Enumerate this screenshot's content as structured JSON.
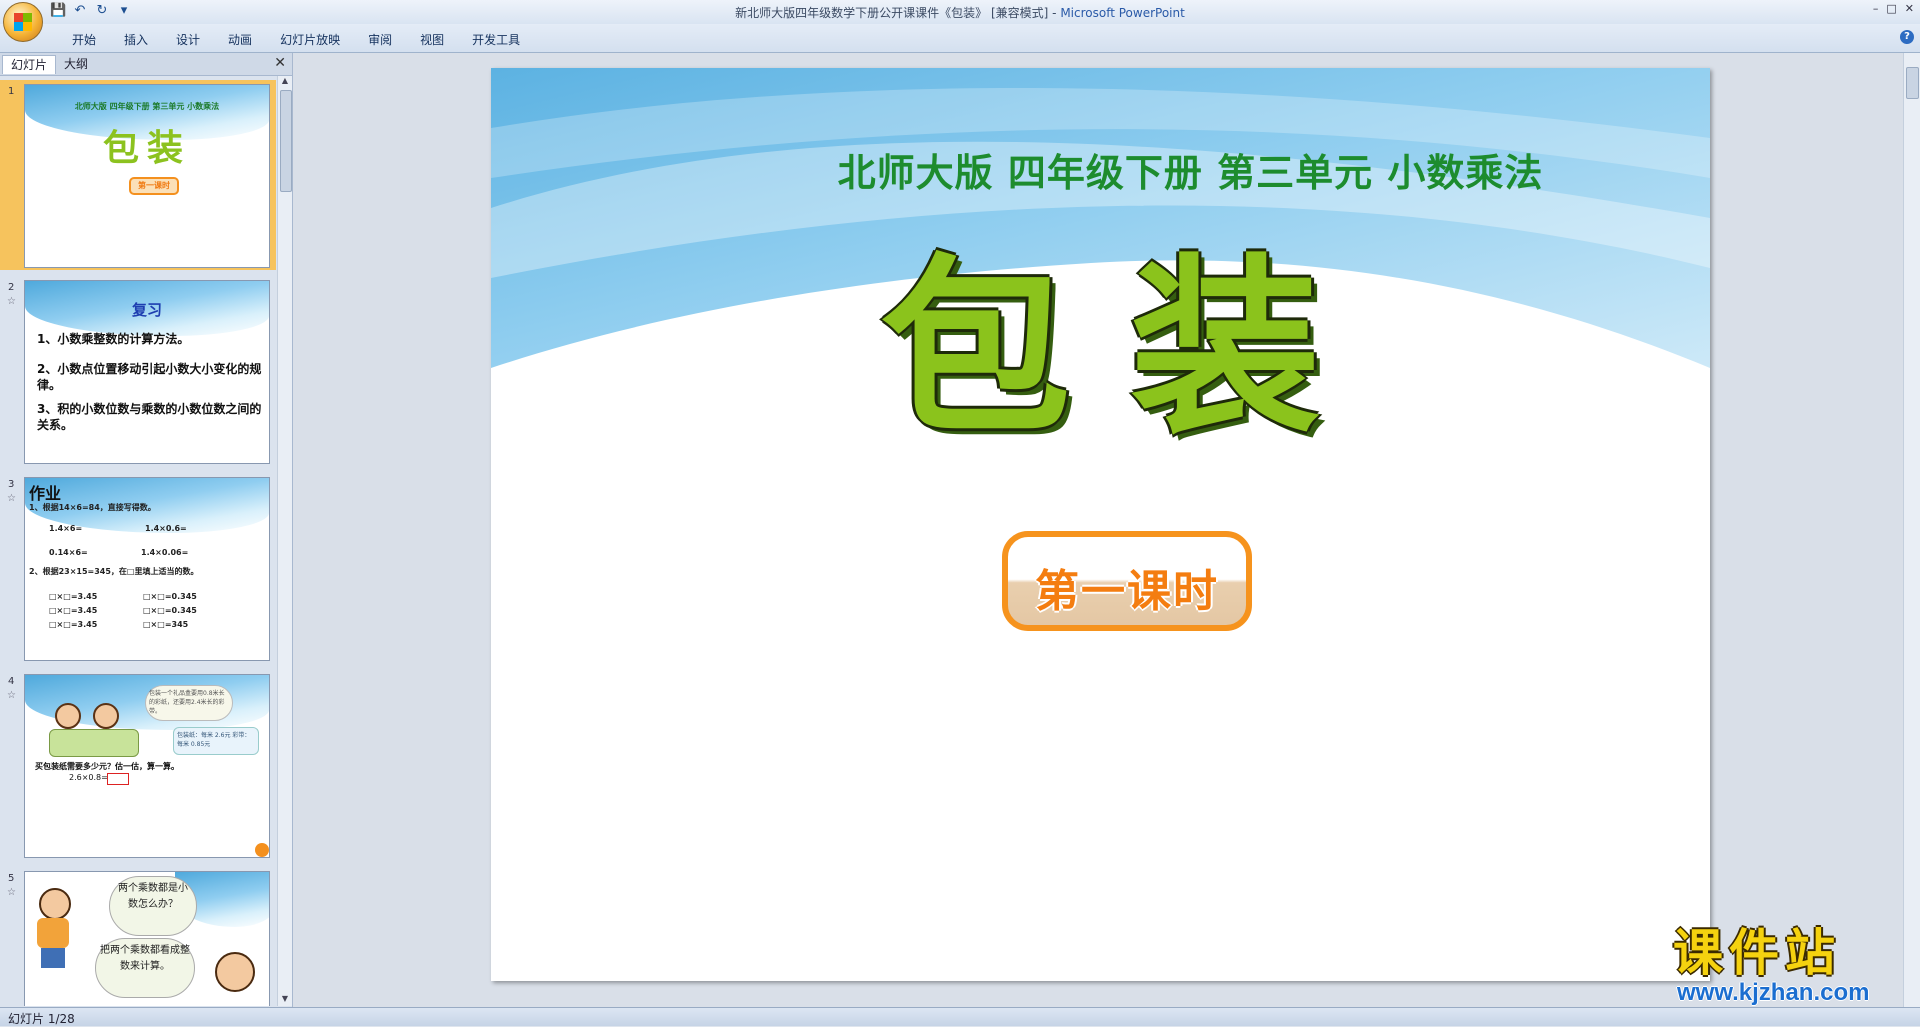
{
  "window": {
    "title": "新北师大版四年级数学下册公开课课件《包装》 [兼容模式] - ",
    "app_name": "Microsoft PowerPoint",
    "minimize": "–",
    "maximize": "□",
    "close": "✕"
  },
  "quick_access": {
    "save": "💾",
    "undo": "↶",
    "redo": "↻",
    "more": "▾"
  },
  "ribbon": {
    "tabs": [
      "开始",
      "插入",
      "设计",
      "动画",
      "幻灯片放映",
      "审阅",
      "视图",
      "开发工具"
    ],
    "help": "?"
  },
  "panel": {
    "tab_slides": "幻灯片",
    "tab_outline": "大纲",
    "close": "✕"
  },
  "thumbnails": {
    "s1": {
      "num": "1",
      "sub": "北师大版  四年级下册  第三单元  小数乘法",
      "title": "包装",
      "button": "第一课时"
    },
    "s2": {
      "num": "2",
      "star": "☆",
      "title": "复习",
      "l1": "1、小数乘整数的计算方法。",
      "l2": "2、小数点位置移动引起小数大小变化的规律。",
      "l3": "3、积的小数位数与乘数的小数位数之间的关系。"
    },
    "s3": {
      "num": "3",
      "star": "☆",
      "title": "作业",
      "q1": "1、根据14×6=84，直接写得数。",
      "a1": "1.4×6=",
      "a2": "1.4×0.6=",
      "a3": "0.14×6=",
      "a4": "1.4×0.06=",
      "q2": "2、根据23×15=345，在□里填上适当的数。",
      "b1": "□×□=3.45",
      "b2": "□×□=0.345",
      "b3": "□×□=3.45",
      "b4": "□×□=0.345",
      "b5": "□×□=3.45",
      "b6": "□×□=345"
    },
    "s4": {
      "num": "4",
      "star": "☆",
      "bubble": "包装一个礼品盒要用0.8米长的彩纸，还要用2.4米长的彩带。",
      "price": "包装纸：每米 2.6元 彩带：每米 0.85元",
      "question": "买包装纸需要多少元？估一估，算一算。",
      "eq": "2.6×0.8="
    },
    "s5": {
      "num": "5",
      "star": "☆",
      "bubble1": "两个乘数都是小数怎么办？",
      "bubble2": "把两个乘数都看成整数来计算。"
    }
  },
  "slide": {
    "subtitle": "北师大版  四年级下册  第三单元  小数乘法",
    "title": "包装",
    "button": "第一课时"
  },
  "statusbar": {
    "text": "幻灯片 1/28"
  },
  "watermark": {
    "cn": "课件站",
    "url": "www.kjzhan.com"
  },
  "colors": {
    "accent_green": "#8bc31c",
    "subtitle_green": "#1d8c2e",
    "button_orange": "#f6931d",
    "selected": "#f6c35d"
  }
}
